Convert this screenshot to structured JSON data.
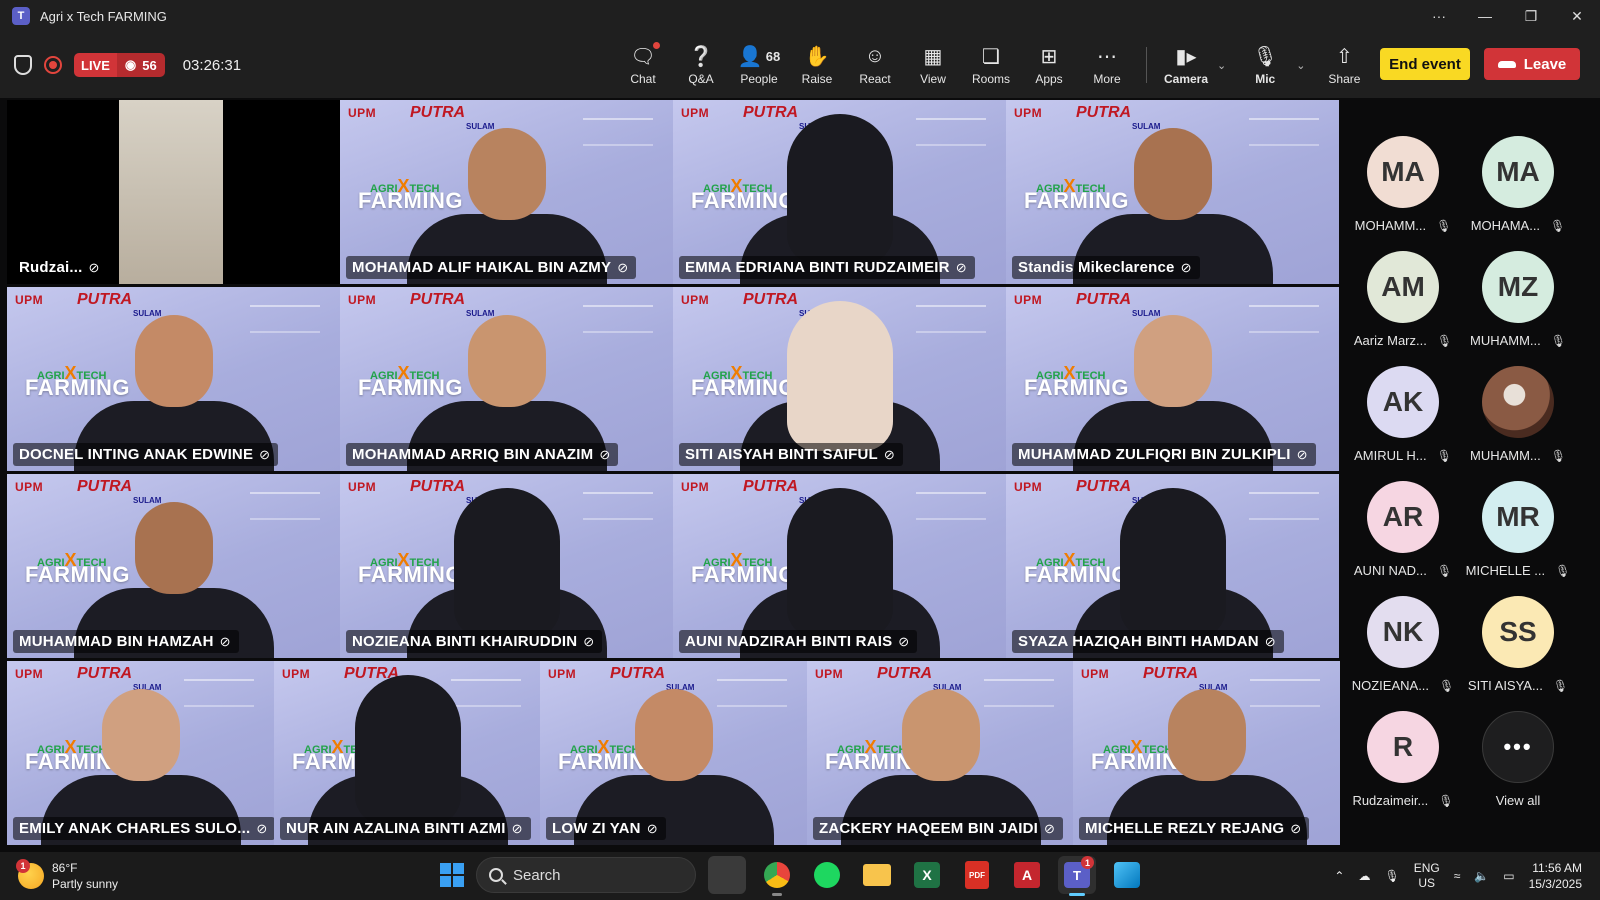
{
  "window": {
    "title": "Agri x Tech FARMING"
  },
  "toolbar": {
    "live_label": "LIVE",
    "viewer_count": "56",
    "elapsed": "03:26:31",
    "buttons": [
      {
        "label": "Chat",
        "icon": "chat-icon"
      },
      {
        "label": "Q&A",
        "icon": "qa-icon"
      },
      {
        "label": "People",
        "icon": "people-icon",
        "count": "68"
      },
      {
        "label": "Raise",
        "icon": "raise-hand-icon"
      },
      {
        "label": "React",
        "icon": "react-icon"
      },
      {
        "label": "View",
        "icon": "view-grid-icon"
      },
      {
        "label": "Rooms",
        "icon": "rooms-icon"
      },
      {
        "label": "Apps",
        "icon": "apps-icon"
      },
      {
        "label": "More",
        "icon": "more-icon"
      }
    ],
    "camera_label": "Camera",
    "mic_label": "Mic",
    "share_label": "Share",
    "end_event_label": "End event",
    "leave_label": "Leave"
  },
  "brand": {
    "upm": "UPM",
    "putra": "PUTRA",
    "sub": "SULAM",
    "agri": "AGRI",
    "x": "X",
    "tech": "TECH",
    "farming": "FARMING"
  },
  "tiles": [
    {
      "name": "Rudzai..."
    },
    {
      "name": "MOHAMAD ALIF HAIKAL BIN AZMY"
    },
    {
      "name": "EMMA EDRIANA BINTI RUDZAIMEIR"
    },
    {
      "name": "Standis Mikeclarence"
    },
    {
      "name": "DOCNEL INTING ANAK EDWINE"
    },
    {
      "name": "MOHAMMAD ARRIQ BIN ANAZIM"
    },
    {
      "name": "SITI AISYAH BINTI SAIFUL"
    },
    {
      "name": "MUHAMMAD ZULFIQRI BIN ZULKIPLI"
    },
    {
      "name": "MUHAMMAD BIN HAMZAH"
    },
    {
      "name": "NOZIEANA BINTI KHAIRUDDIN"
    },
    {
      "name": "AUNI NADZIRAH BINTI RAIS"
    },
    {
      "name": "SYAZA HAZIQAH BINTI HAMDAN"
    },
    {
      "name": "EMILY ANAK CHARLES SULO..."
    },
    {
      "name": "NUR AIN AZALINA BINTI AZMI"
    },
    {
      "name": "LOW ZI YAN"
    },
    {
      "name": "ZACKERY HAQEEM BIN JAIDI"
    },
    {
      "name": "MICHELLE REZLY REJANG"
    }
  ],
  "roster": [
    {
      "initials": "MA",
      "name": "MOHAMM...",
      "color": "#f1ddd3"
    },
    {
      "initials": "MA",
      "name": "MOHAMA...",
      "color": "#d5ecdf"
    },
    {
      "initials": "AM",
      "name": "Aariz Marz...",
      "color": "#e1e8d8"
    },
    {
      "initials": "MZ",
      "name": "MUHAMM...",
      "color": "#d5ecdf"
    },
    {
      "initials": "AK",
      "name": "AMIRUL H...",
      "color": "#dcdaf2"
    },
    {
      "initials": "",
      "name": "MUHAMM...",
      "color": "#8a5a44"
    },
    {
      "initials": "AR",
      "name": "AUNI NAD...",
      "color": "#f6d6e2"
    },
    {
      "initials": "MR",
      "name": "MICHELLE ...",
      "color": "#d3eef0"
    },
    {
      "initials": "NK",
      "name": "NOZIEANA...",
      "color": "#e3ddef"
    },
    {
      "initials": "SS",
      "name": "SITI AISYA...",
      "color": "#fbe9b4"
    },
    {
      "initials": "R",
      "name": "Rudzaimeir...",
      "color": "#f6d6e2"
    },
    {
      "initials": "•••",
      "name": "View all",
      "color": "#1e1e1f"
    }
  ],
  "taskbar": {
    "weather_temp": "86°F",
    "weather_desc": "Partly sunny",
    "weather_badge": "1",
    "search_placeholder": "Search",
    "lang_top": "ENG",
    "lang_bottom": "US",
    "time": "11:56 AM",
    "date": "15/3/2025",
    "teams_badge": "1"
  }
}
